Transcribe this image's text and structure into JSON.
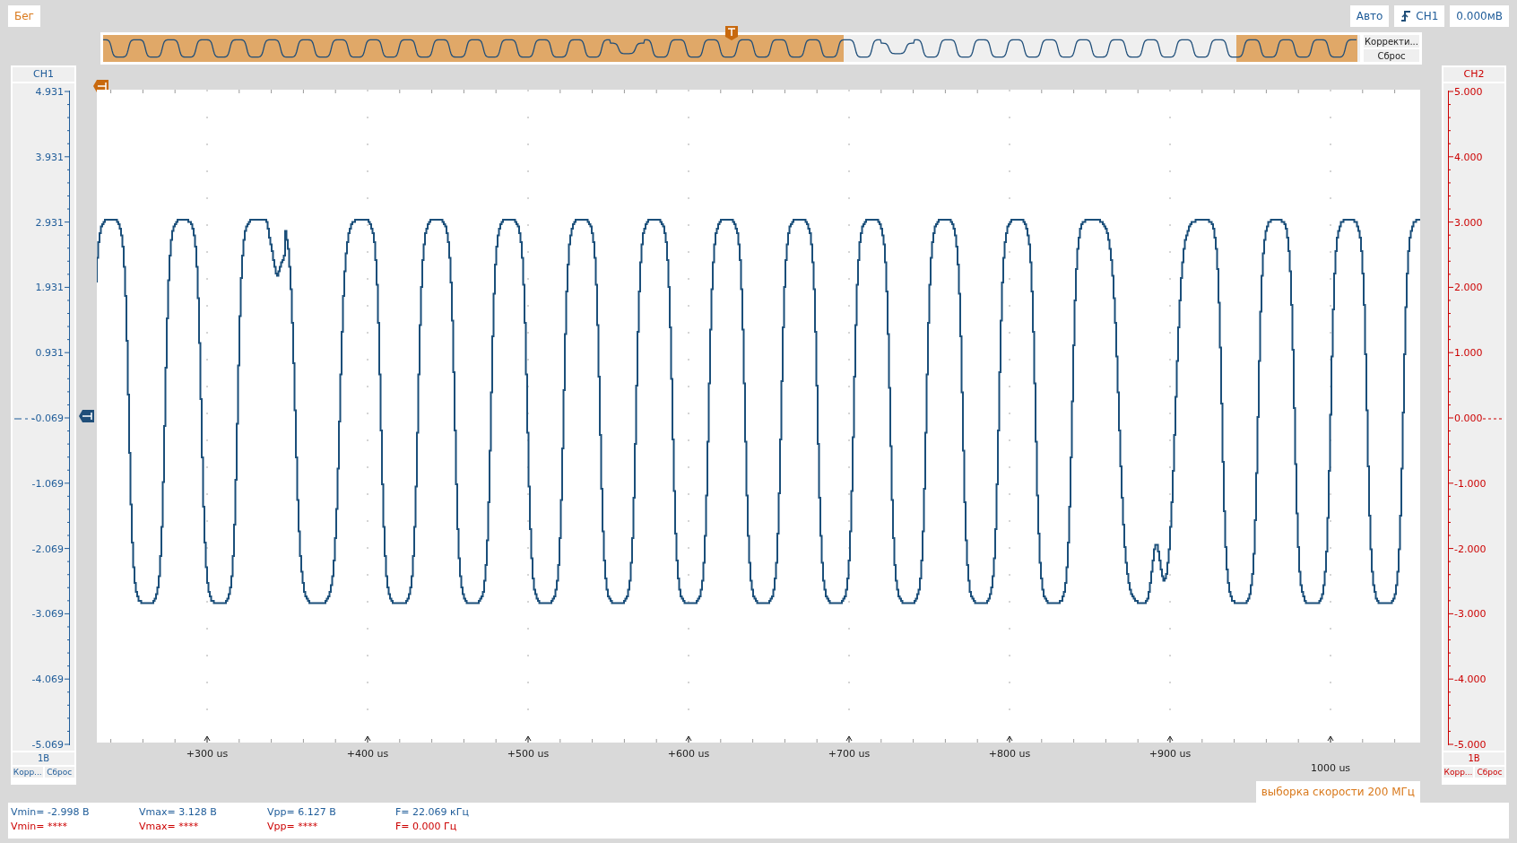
{
  "top_bar": {
    "run_button": "Бег",
    "mode_button": "Авто",
    "trigger_source": "CH1",
    "trigger_level": "0.000мВ"
  },
  "overview": {
    "buttons": [
      "Корректи...",
      "Сброс"
    ]
  },
  "channels": [
    {
      "name": "CH1",
      "color": "#1f5c99",
      "ticks": [
        "4.931",
        "3.931",
        "2.931",
        "1.931",
        "0.931",
        "-0.069",
        "-1.069",
        "-2.069",
        "-3.069",
        "-4.069",
        "-5.069"
      ],
      "scale": "1В",
      "buttons": [
        "Корр...",
        "Сброс"
      ]
    },
    {
      "name": "CH2",
      "color": "#cc0000",
      "ticks": [
        "5.000",
        "4.000",
        "3.000",
        "2.000",
        "1.000",
        "0.000",
        "-1.000",
        "-2.000",
        "-3.000",
        "-4.000",
        "-5.000"
      ],
      "scale": "1В",
      "buttons": [
        "Корр...",
        "Сброс"
      ]
    }
  ],
  "x_axis": {
    "labels": [
      {
        "text": "+300 us",
        "kind": "major"
      },
      {
        "text": "+400 us",
        "kind": "major"
      },
      {
        "text": "+500 us",
        "kind": "major"
      },
      {
        "text": "+600 us",
        "kind": "major"
      },
      {
        "text": "+700 us",
        "kind": "major"
      },
      {
        "text": "+800 us",
        "kind": "major"
      },
      {
        "text": "+900 us",
        "kind": "major"
      },
      {
        "text": "1000 us",
        "kind": "end"
      }
    ]
  },
  "sample_rate": "выборка скорости 200 МГц",
  "measurements": [
    {
      "color": "#1f5c99",
      "items": [
        "Vmin= -2.998 В",
        "Vmax= 3.128 В",
        "Vpp= 6.127 В",
        "F= 22.069 кГц"
      ]
    },
    {
      "color": "#cc0000",
      "items": [
        "Vmin= ****",
        "Vmax= ****",
        "Vpp= ****",
        "F= 0.000 Гц"
      ]
    }
  ]
}
